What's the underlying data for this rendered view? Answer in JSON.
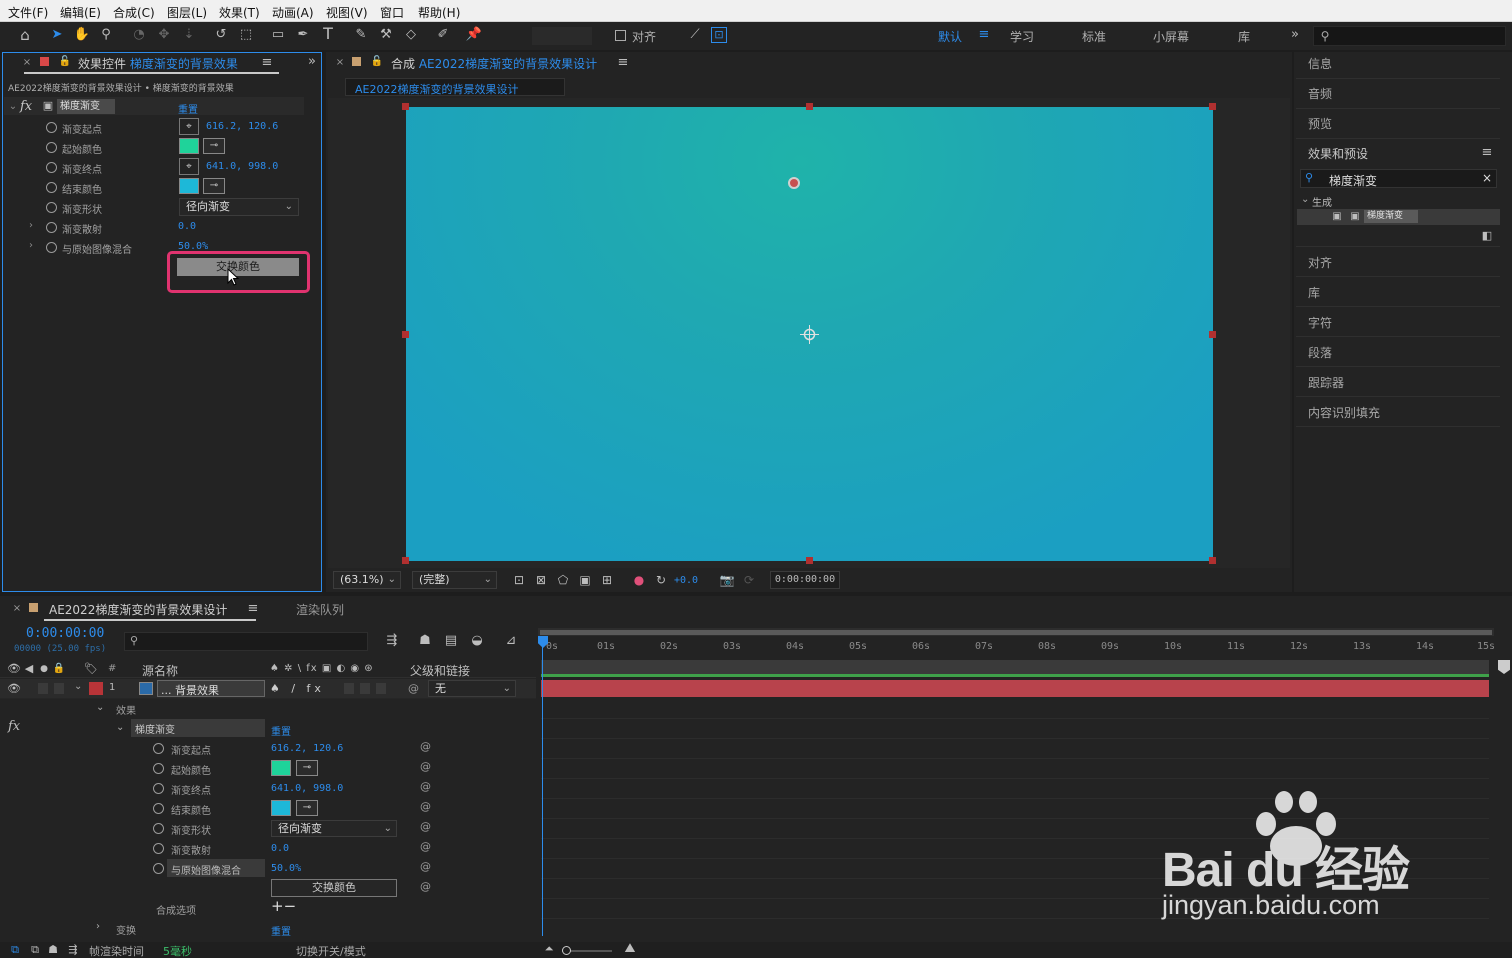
{
  "menu": [
    "文件(F)",
    "编辑(E)",
    "合成(C)",
    "图层(L)",
    "效果(T)",
    "动画(A)",
    "视图(V)",
    "窗口",
    "帮助(H)"
  ],
  "toolbar": {
    "align_label": "对齐",
    "workspaces": [
      "默认",
      "学习",
      "标准",
      "小屏幕",
      "库"
    ],
    "active_workspace": "默认"
  },
  "effect_controls": {
    "tab_prefix": "效果控件",
    "tab_layer": "梯度渐变的背景效果",
    "breadcrumb": "AE2022梯度渐变的背景效果设计 • 梯度渐变的背景效果",
    "effect_name": "梯度渐变",
    "reset": "重置",
    "props": [
      {
        "label": "渐变起点",
        "value": "616.2, 120.6"
      },
      {
        "label": "起始颜色",
        "value": ""
      },
      {
        "label": "渐变终点",
        "value": "641.0, 998.0"
      },
      {
        "label": "结束颜色",
        "value": ""
      },
      {
        "label": "渐变形状",
        "value": "径向渐变"
      },
      {
        "label": "渐变散射",
        "value": "0.0"
      },
      {
        "label": "与原始图像混合",
        "value": "50.0%"
      }
    ],
    "swap_button": "交换颜色",
    "start_color": "#1fd39a",
    "end_color": "#1db8d8"
  },
  "composition": {
    "tab_prefix": "合成",
    "tab_name": "AE2022梯度渐变的背景效果设计",
    "subtab": "AE2022梯度渐变的背景效果设计",
    "zoom": "(63.1%)",
    "quality": "(完整)",
    "exposure": "+0.0",
    "timecode": "0:00:00:00",
    "canvas_color": "#1fa3b5"
  },
  "right_panel": {
    "items_top": [
      "信息",
      "音频",
      "预览"
    ],
    "effects_title": "效果和预设",
    "search_value": "梯度渐变",
    "category": "生成",
    "result": "梯度渐变",
    "items_bottom": [
      "对齐",
      "库",
      "字符",
      "段落",
      "跟踪器",
      "内容识别填充"
    ]
  },
  "timeline": {
    "tab_name": "AE2022梯度渐变的背景效果设计",
    "render_queue": "渲染队列",
    "timecode": "0:00:00:00",
    "frames": "00000 (25.00 fps)",
    "col_source": "源名称",
    "col_parent": "父级和链接",
    "layer_num": "1",
    "layer_name": "... 背景效果",
    "parent_value": "无",
    "effects_group": "效果",
    "effect_name": "梯度渐变",
    "reset": "重置",
    "props": [
      {
        "label": "渐变起点",
        "value": "616.2, 120.6"
      },
      {
        "label": "起始颜色",
        "value": ""
      },
      {
        "label": "渐变终点",
        "value": "641.0, 998.0"
      },
      {
        "label": "结束颜色",
        "value": ""
      },
      {
        "label": "渐变形状",
        "value": "径向渐变"
      },
      {
        "label": "渐变散射",
        "value": "0.0"
      },
      {
        "label": "与原始图像混合",
        "value": "50.0%"
      }
    ],
    "swap_button": "交换颜色",
    "composite_options": "合成选项",
    "transform": "变换",
    "ticks": [
      "0s",
      "01s",
      "02s",
      "03s",
      "04s",
      "05s",
      "06s",
      "07s",
      "08s",
      "09s",
      "10s",
      "11s",
      "12s",
      "13s",
      "14s",
      "15s"
    ],
    "layer_bar_color": "#b8434c"
  },
  "statusbar": {
    "render_label": "帧渲染时间",
    "render_value": "5毫秒",
    "toggle_label": "切换开关/模式"
  },
  "watermark": {
    "brand": "Bai du 经验",
    "url": "jingyan.baidu.com"
  }
}
